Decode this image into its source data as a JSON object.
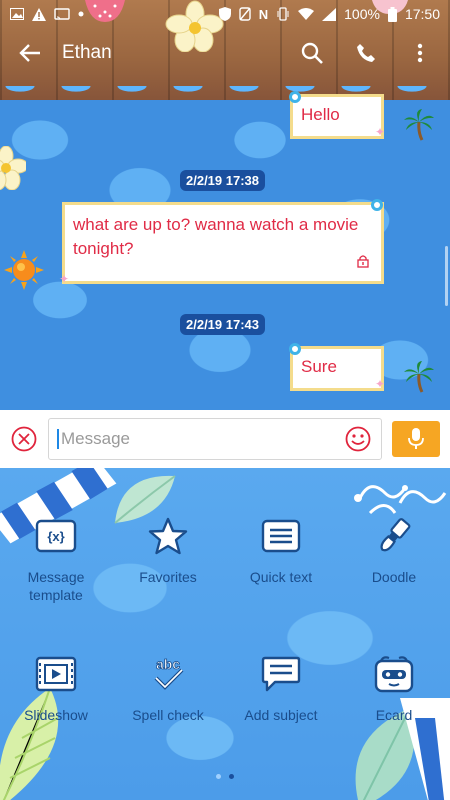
{
  "status_bar": {
    "battery": "100%",
    "time": "17:50"
  },
  "header": {
    "contact_name": "Ethan"
  },
  "messages": [
    {
      "type": "sent",
      "text": "Hello"
    },
    {
      "type": "date",
      "text": "2/2/19 17:38"
    },
    {
      "type": "received",
      "text": "what are up to? wanna watch a movie tonight?"
    },
    {
      "type": "date",
      "text": "2/2/19 17:43"
    },
    {
      "type": "sent",
      "text": "Sure"
    }
  ],
  "composer": {
    "placeholder": "Message"
  },
  "options": [
    {
      "label": "Message template",
      "icon": "message-template-icon"
    },
    {
      "label": "Favorites",
      "icon": "star-icon"
    },
    {
      "label": "Quick text",
      "icon": "quick-text-icon"
    },
    {
      "label": "Doodle",
      "icon": "doodle-brush-icon"
    },
    {
      "label": "Slideshow",
      "icon": "slideshow-icon"
    },
    {
      "label": "Spell check",
      "icon": "spell-check-icon"
    },
    {
      "label": "Add subject",
      "icon": "add-subject-icon"
    },
    {
      "label": "Ecard",
      "icon": "ecard-icon"
    }
  ],
  "pager": {
    "pages": 2,
    "current": 2
  },
  "colors": {
    "bubble_text": "#e02b46",
    "bubble_border": "#f4dc8c",
    "date_pill": "#1a4f9e",
    "voice_button": "#f6a623",
    "pool_blue": "#3f8fe0"
  }
}
